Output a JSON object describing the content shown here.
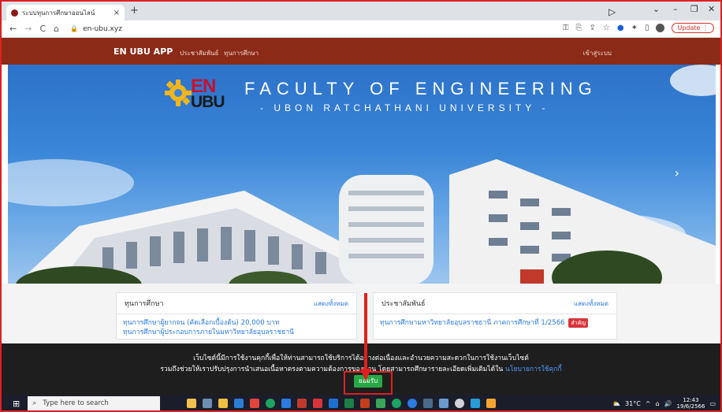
{
  "browser": {
    "tab_title": "ระบบทุนการศึกษาออนไลน์",
    "tab_close": "×",
    "new_tab": "+",
    "url": "en-ubu.xyz",
    "update_label": "Update",
    "window_controls": [
      "⌄",
      "–",
      "❐",
      "✕"
    ]
  },
  "navbar": {
    "brand": "EN UBU APP",
    "links": [
      "ประชาสัมพันธ์",
      "ทุนการศึกษา"
    ],
    "login": "เข้าสู่ระบบ"
  },
  "hero": {
    "logo_en": "EN",
    "logo_ubu": "UBU",
    "title": "FACULTY OF ENGINEERING",
    "subtitle": "- UBON RATCHATHANI UNIVERSITY -",
    "next_arrow": "›"
  },
  "cards": [
    {
      "title": "ทุนการศึกษา",
      "see_all": "แสดงทั้งหมด",
      "items": [
        "ทุนการศึกษาผู้ยากจน (คัดเลือกเบื้องต้น) 20,000 บาท",
        "ทุนการศึกษาผู้ประกอบการภายในมหาวิทยาลัยอุบลราชธานี"
      ]
    },
    {
      "title": "ประชาสัมพันธ์",
      "see_all": "แสดงทั้งหมด",
      "items": [
        "ทุนการศึกษามหาวิทยาลัยอุบลราชธานี ภาคการศึกษาที่ 1/2566"
      ],
      "badge": "สำคัญ"
    }
  ],
  "cookie": {
    "line1": "เว็บไซต์นี้มีการใช้งานคุกกี้เพื่อให้ท่านสามารถใช้บริการได้อย่างต่อเนื่องและอำนวยความสะดวกในการใช้งานเว็บไซต์",
    "line2": "รวมถึงช่วยให้เราปรับปรุงการนำเสนอเนื้อหาตรงตามความต้องการของท่าน โดยสามารถศึกษารายละเอียดเพิ่มเติมได้ใน",
    "policy_link": "นโยบายการใช้คุกกี้",
    "accept": "ยอมรับ"
  },
  "taskbar": {
    "search_placeholder": "Type here to search",
    "weather": "31°C",
    "time": "12:43",
    "date": "19/6/2566"
  },
  "colors": {
    "navbar": "#8b2a17",
    "link": "#2a7ae2",
    "accept": "#28a745",
    "annotation": "#e02020"
  }
}
